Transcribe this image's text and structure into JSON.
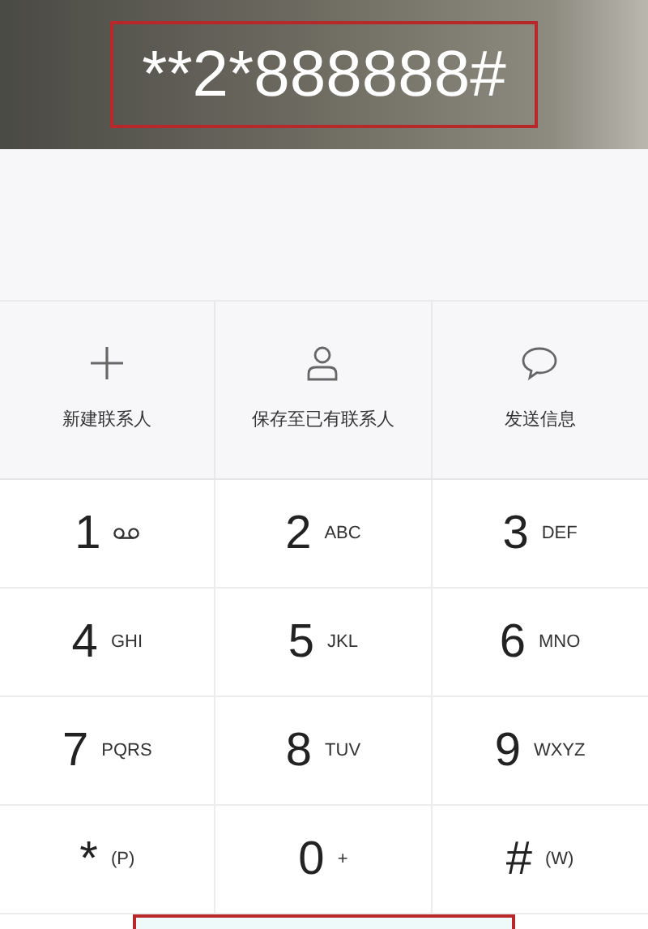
{
  "dialed_number": "**2*888888#",
  "actions": [
    {
      "kind": "add",
      "label": "新建联系人"
    },
    {
      "kind": "person",
      "label": "保存至已有联系人"
    },
    {
      "kind": "message",
      "label": "发送信息"
    }
  ],
  "keys": [
    {
      "digit": "1",
      "kind": "voicemail"
    },
    {
      "digit": "2",
      "letters": "ABC"
    },
    {
      "digit": "3",
      "letters": "DEF"
    },
    {
      "digit": "4",
      "letters": "GHI"
    },
    {
      "digit": "5",
      "letters": "JKL"
    },
    {
      "digit": "6",
      "letters": "MNO"
    },
    {
      "digit": "7",
      "letters": "PQRS"
    },
    {
      "digit": "8",
      "letters": "TUV"
    },
    {
      "digit": "9",
      "letters": "WXYZ"
    },
    {
      "digit": "*",
      "letters": "(P)"
    },
    {
      "digit": "0",
      "letters": "+"
    },
    {
      "digit": "#",
      "letters": "(W)"
    }
  ]
}
